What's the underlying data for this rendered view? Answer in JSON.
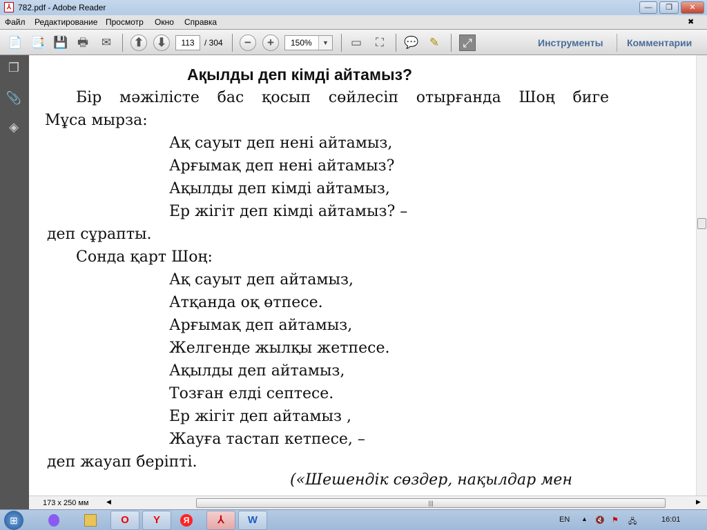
{
  "window": {
    "title": "782.pdf - Adobe Reader",
    "minimize": "—",
    "restore": "❐",
    "close": "✕"
  },
  "menu": {
    "items": [
      "Файл",
      "Редактирование",
      "Просмотр",
      "Окно",
      "Справка"
    ],
    "close_doc": "✖"
  },
  "toolbar": {
    "page_current": "113",
    "page_total": "/ 304",
    "zoom": "150%",
    "tools_label": "Инструменты",
    "comments_label": "Комментарии"
  },
  "document": {
    "heading": "Ақылды деп кімді айтамыз?",
    "lines": [
      "Бір мәжілісте бас қосып сөйлесіп отырғанда Шоң биге",
      "Мұса мырза:",
      "Ақ сауыт деп нені айтамыз,",
      "Арғымақ деп нені айтамыз?",
      "Ақылды деп кімді айтамыз,",
      "Ер жігіт деп кімді айтамыз? –",
      "деп сұрапты.",
      "Сонда қарт Шоң:",
      "Ақ сауыт деп айтамыз,",
      "Атқанда оқ өтпесе.",
      "Арғымақ деп айтамыз,",
      "Желгенде жылқы жетпесе.",
      "Ақылды деп айтамыз,",
      "Тозған елді септесе.",
      "Ер жігіт деп айтамыз ,",
      "Жауға тастап кетпесе, –",
      "деп жауап беріпті.",
      "(«Шешендік сөздер, нақылдар мен"
    ]
  },
  "status": {
    "page_size": "173 x 250 мм"
  },
  "taskbar": {
    "apps": [
      "alice",
      "explorer",
      "opera",
      "yandex-browser",
      "yandex",
      "adobe-reader",
      "word"
    ],
    "language": "EN",
    "time": "16:01",
    "active_app": "adobe-reader"
  }
}
